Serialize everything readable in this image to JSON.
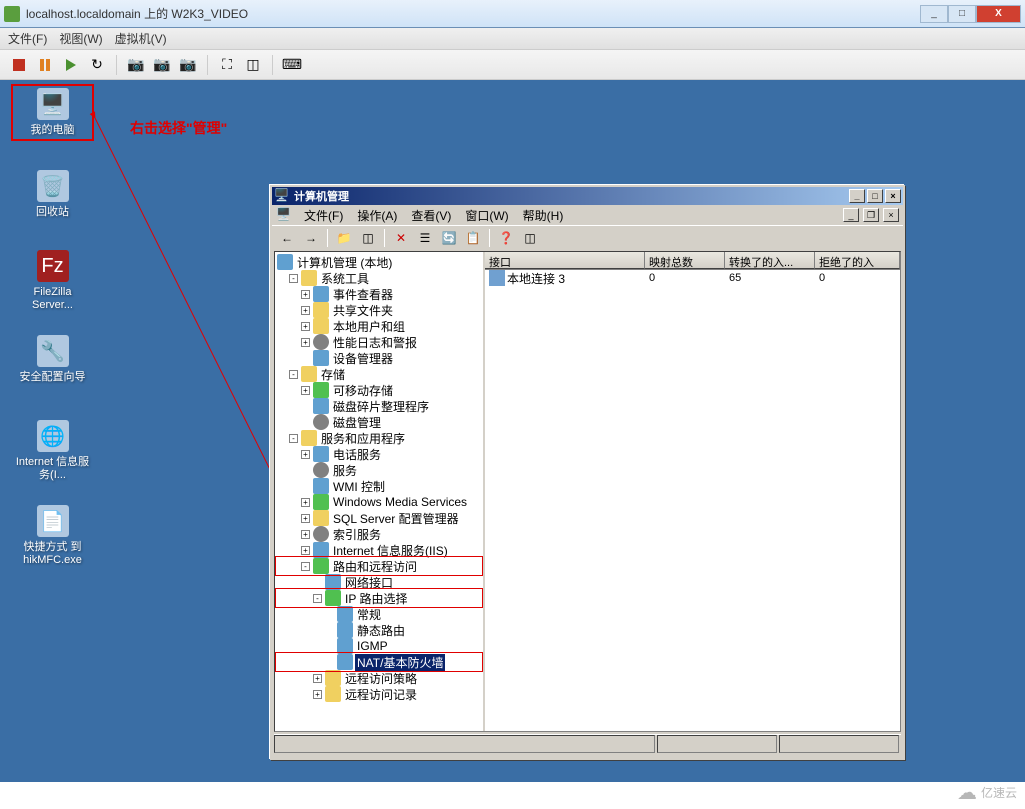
{
  "vmware": {
    "title": "localhost.localdomain 上的 W2K3_VIDEO",
    "menu": {
      "file": "文件(F)",
      "view": "视图(W)",
      "vm": "虚拟机(V)"
    }
  },
  "desktop": {
    "icons": {
      "mycomputer": "我的电脑",
      "recycle": "回收站",
      "filezilla": "FileZilla Server...",
      "secwizard": "安全配置向导",
      "iis": "Internet 信息服务(I...",
      "shortcut": "快捷方式 到 hikMFC.exe"
    }
  },
  "annotation": {
    "text": "右击选择\"管理\""
  },
  "mmc": {
    "title": "计算机管理",
    "menu": {
      "file": "文件(F)",
      "action": "操作(A)",
      "view": "查看(V)",
      "window": "窗口(W)",
      "help": "帮助(H)"
    },
    "tree": {
      "root": "计算机管理 (本地)",
      "systools": "系统工具",
      "eventviewer": "事件查看器",
      "sharedfolders": "共享文件夹",
      "localusers": "本地用户和组",
      "perflogs": "性能日志和警报",
      "devmgr": "设备管理器",
      "storage": "存储",
      "removable": "可移动存储",
      "defrag": "磁盘碎片整理程序",
      "diskmgmt": "磁盘管理",
      "services": "服务和应用程序",
      "telephony": "电话服务",
      "svcs": "服务",
      "wmi": "WMI 控制",
      "wms": "Windows Media Services",
      "sqlserver": "SQL Server 配置管理器",
      "indexing": "索引服务",
      "iis": "Internet 信息服务(IIS)",
      "rras": "路由和远程访问",
      "netif": "网络接口",
      "iprouting": "IP 路由选择",
      "general": "常规",
      "static": "静态路由",
      "igmp": "IGMP",
      "nat": "NAT/基本防火墙",
      "rapolicies": "远程访问策略",
      "ralog": "远程访问记录"
    },
    "list": {
      "columns": {
        "interface": "接口",
        "mappings": "映射总数",
        "inbound": "转换了的入...",
        "rejected": "拒绝了的入"
      },
      "row": {
        "name": "本地连接 3",
        "mappings": "0",
        "inbound": "65",
        "rejected": "0"
      }
    }
  },
  "watermark": "亿速云"
}
